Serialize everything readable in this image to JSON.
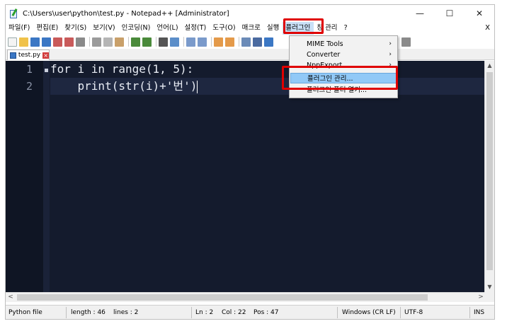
{
  "window": {
    "title": "C:\\Users\\user\\python\\test.py - Notepad++ [Administrator]",
    "controls": {
      "minimize": "—",
      "maximize": "☐",
      "close": "✕"
    }
  },
  "menubar": {
    "items": [
      {
        "name": "menu-file",
        "label": "파일(F)"
      },
      {
        "name": "menu-edit",
        "label": "편집(E)"
      },
      {
        "name": "menu-search",
        "label": "찾기(S)"
      },
      {
        "name": "menu-view",
        "label": "보기(V)"
      },
      {
        "name": "menu-encoding",
        "label": "인코딩(N)"
      },
      {
        "name": "menu-language",
        "label": "언어(L)"
      },
      {
        "name": "menu-settings",
        "label": "설정(T)"
      },
      {
        "name": "menu-tools",
        "label": "도구(O)"
      },
      {
        "name": "menu-macro",
        "label": "매크로"
      },
      {
        "name": "menu-run",
        "label": "실행"
      },
      {
        "name": "menu-plugins",
        "label": "플러그인"
      },
      {
        "name": "menu-window",
        "label": "창 관리"
      },
      {
        "name": "menu-help",
        "label": "?"
      }
    ],
    "close_doc": "X"
  },
  "tab": {
    "label": "test.py",
    "close": "×"
  },
  "tabbar_right": "",
  "editor": {
    "lines": [
      {
        "num": "1",
        "text": "for i in range(1, 5):"
      },
      {
        "num": "2",
        "text": "    print(str(i)+'번')"
      }
    ]
  },
  "plugins_menu": {
    "items": [
      {
        "label": "MIME Tools",
        "submenu": true
      },
      {
        "label": "Converter",
        "submenu": true
      },
      {
        "label": "NppExport",
        "submenu": true
      },
      {
        "label": "플러그인 관리...",
        "submenu": false,
        "highlighted": true
      },
      {
        "label": "플러그인 폴더 열기...",
        "submenu": false
      }
    ],
    "chevron": "›"
  },
  "statusbar": {
    "file_type": "Python file",
    "length": "length : 46",
    "lines": "lines : 2",
    "ln": "Ln : 2",
    "col": "Col : 22",
    "pos": "Pos : 47",
    "eol": "Windows (CR LF)",
    "encoding": "UTF-8",
    "mode": "INS"
  },
  "scroll": {
    "up": "▲",
    "down": "▼",
    "left": "<",
    "right": ">"
  },
  "colors": {
    "editor_bg": "#141b2d",
    "highlight_red": "#e00000",
    "menu_highlight": "#91c9f7"
  }
}
